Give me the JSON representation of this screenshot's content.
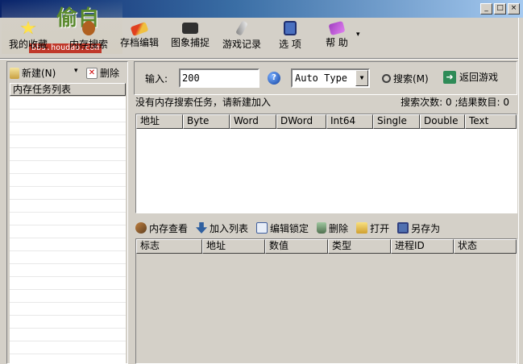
{
  "logo": {
    "text": "偷自",
    "url": "bbs.houdao.com"
  },
  "window_controls": {
    "minimize": "_",
    "maximize": "□",
    "close": "×"
  },
  "toolbar": {
    "items": [
      {
        "label": "我的收藏",
        "icon": "star-icon"
      },
      {
        "label": "内存搜索",
        "icon": "memory-search-icon"
      },
      {
        "label": "存档编辑",
        "icon": "save-edit-icon"
      },
      {
        "label": "图象捕捉",
        "icon": "camera-icon"
      },
      {
        "label": "游戏记录",
        "icon": "record-icon"
      },
      {
        "label": "选 项",
        "icon": "options-icon"
      },
      {
        "label": "帮 助",
        "icon": "help-icon"
      }
    ],
    "more": "▾"
  },
  "left_panel": {
    "new_label": "新建(N)",
    "new_arrow": "▾",
    "delete_label": "删除",
    "list_header": "内存任务列表"
  },
  "search": {
    "input_label": "输入:",
    "input_value": "200",
    "type_value": "Auto Type",
    "search_button": "搜索(M)",
    "return_button": "返回游戏",
    "help_glyph": "?"
  },
  "status": {
    "message": "没有内存搜索任务，请新建加入",
    "counts": "搜索次数: 0 ;结果数目: 0"
  },
  "result_columns": [
    "地址",
    "Byte",
    "Word",
    "DWord",
    "Int64",
    "Single",
    "Double",
    "Text"
  ],
  "bottom_toolbar": [
    {
      "label": "内存查看",
      "icon": "memory-view-icon"
    },
    {
      "label": "加入列表",
      "icon": "add-list-icon"
    },
    {
      "label": "编辑锁定",
      "icon": "edit-lock-icon"
    },
    {
      "label": "删除",
      "icon": "delete-icon"
    },
    {
      "label": "打开",
      "icon": "open-icon"
    },
    {
      "label": "另存为",
      "icon": "save-as-icon"
    }
  ],
  "watch_columns": [
    "标志",
    "地址",
    "数值",
    "类型",
    "进程ID",
    "状态"
  ],
  "colors": {
    "title_start": "#0a246a",
    "title_end": "#a6caf0",
    "face": "#d4d0c8",
    "accent_green": "#2e8b57"
  }
}
